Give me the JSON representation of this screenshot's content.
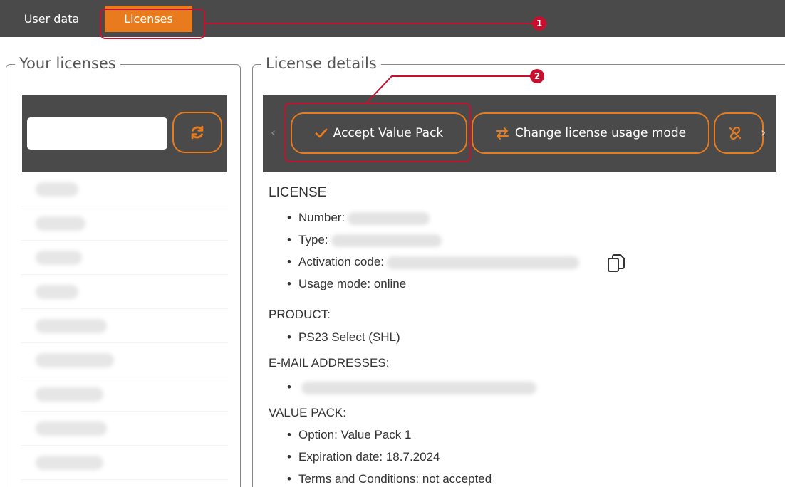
{
  "tabs": [
    {
      "label": "User data"
    },
    {
      "label": "Licenses"
    }
  ],
  "annotations": [
    "1",
    "2"
  ],
  "left_panel": {
    "legend": "Your licenses",
    "search_value": "",
    "refresh_icon": "refresh-icon"
  },
  "right_panel": {
    "legend": "License details",
    "buttons": {
      "accept": "Accept Value Pack",
      "change_mode": "Change license usage mode",
      "unlink_icon": "unlink-icon"
    }
  },
  "license": {
    "title": "LICENSE",
    "number_label": "Number:",
    "type_label": "Type:",
    "activation_label": "Activation code:",
    "usage_mode": "Usage mode: online"
  },
  "product": {
    "title": "PRODUCT:",
    "name": "PS23 Select (SHL)"
  },
  "emails": {
    "title": "E-MAIL ADDRESSES:"
  },
  "value_pack": {
    "title": "VALUE PACK:",
    "option": "Option: Value Pack 1",
    "expiration": "Expiration date: 18.7.2024",
    "terms": "Terms and Conditions: not accepted"
  },
  "colors": {
    "accent": "#e77b1d",
    "toolbar": "#4a4a4a",
    "annotation": "#c8102e"
  }
}
